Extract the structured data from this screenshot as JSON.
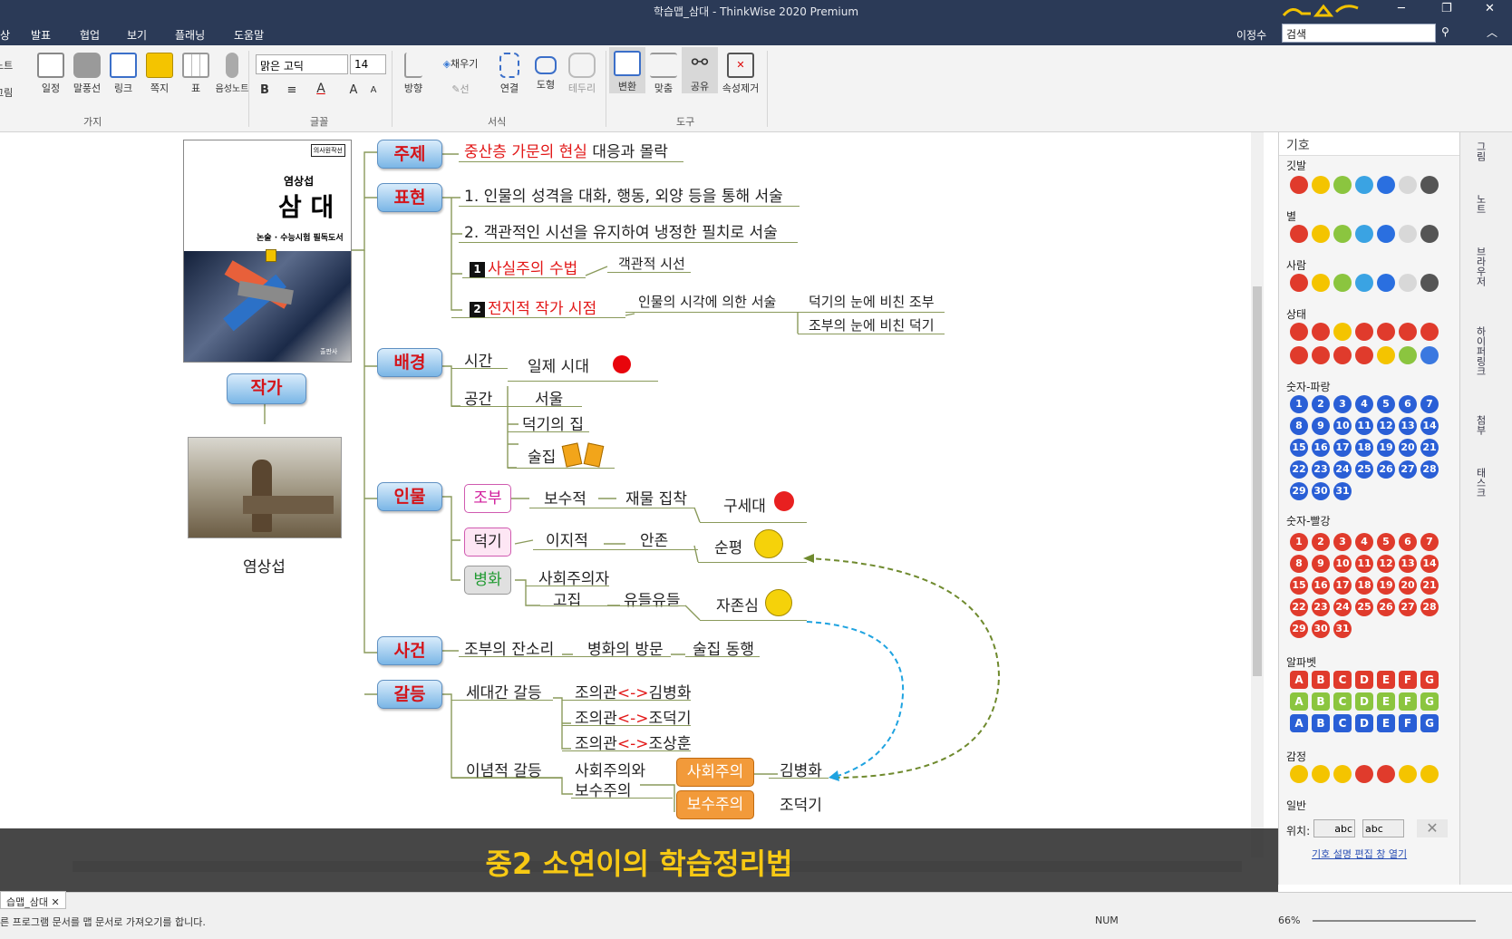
{
  "window": {
    "title": "학습맵_삼대 - ThinkWise 2020 Premium",
    "user": "이정수",
    "search_placeholder": "검색"
  },
  "menu": [
    "발표",
    "협업",
    "보기",
    "플래닝",
    "도움말"
  ],
  "menu_left_partial": "상",
  "ribbon": {
    "left_partial": [
      "노트",
      "그림"
    ],
    "branch": [
      "일정",
      "말풍선",
      "링크",
      "쪽지",
      "표",
      "음성노트"
    ],
    "branch_group": "가지",
    "font_name": "맑은 고딕",
    "font_size": "14",
    "font_group": "글꼴",
    "style": [
      "방향",
      "채우기",
      "선",
      "연결",
      "도형",
      "테두리"
    ],
    "style_group": "서식",
    "tools": [
      "변환",
      "맞춤",
      "공유",
      "속성제거"
    ],
    "tools_group": "도구"
  },
  "map": {
    "book": {
      "series": "의사원작선",
      "author": "염상섭",
      "title": "삼 대",
      "subtitle": "논술 · 수능시험 필독도서",
      "publisher": "출판사"
    },
    "author_label": "작가",
    "author_name": "염상섭",
    "topics": [
      "주제",
      "표현",
      "배경",
      "인물",
      "사건",
      "갈등"
    ],
    "theme": {
      "red": "중산층 가문의 현실",
      "black": "대응과 몰락"
    },
    "expr": {
      "e1": "1. 인물의 성격을 대화, 행동, 외양 등을 통해 서술",
      "e2": "2. 객관적인 시선을 유지하여 냉정한 필치로 서술",
      "n1": "1",
      "t1": "사실주의 수법",
      "t1c": "객관적 시선",
      "n2": "2",
      "t2": "전지적 작가 시점",
      "t2c": "인물의 시각에 의한 서술",
      "t2d1": "덕기의 눈에 비친 조부",
      "t2d2": "조부의 눈에 비친 덕기"
    },
    "setting": {
      "time": "시간",
      "time_v": "일제 시대",
      "space": "공간",
      "s1": "서울",
      "s2": "덕기의 집",
      "s3": "술집"
    },
    "chars": {
      "c1": "조부",
      "c1a": "보수적",
      "c1b": "재물 집착",
      "c1c": "구세대",
      "c2": "덕기",
      "c2a": "이지적",
      "c2b": "안존",
      "c2c": "순평",
      "c3": "병화",
      "c3a": "사회주의자",
      "c3b": "고집",
      "c3c": "유들유들",
      "c3d": "자존심"
    },
    "events": {
      "e1": "조부의 잔소리",
      "e2": "병화의 방문",
      "e3": "술집 동행"
    },
    "conflict": {
      "g1": "세대간 갈등",
      "g1a": "조의관",
      "g1b": "조의관",
      "g1c": "조의관",
      "arrow": "<->",
      "g1a2": "김병화",
      "g1b2": "조덕기",
      "g1c2": "조상훈",
      "g2": "이념적 갈등",
      "g2a": "사회주의와",
      "g2b": "보수주의",
      "g2c": "사회주의",
      "g2d": "김병화",
      "g2e": "보수주의",
      "g2f": "조덕기"
    }
  },
  "symbols": {
    "title": "기호",
    "sections": [
      "깃발",
      "별",
      "사람",
      "상태",
      "숫자-파랑",
      "숫자-빨강",
      "알파벳",
      "감정",
      "일반"
    ],
    "letters": [
      "A",
      "B",
      "C",
      "D",
      "E",
      "F",
      "G"
    ],
    "position_label": "위치:",
    "pos1": "abc",
    "pos2": "abc",
    "link": "기호 설명 편집 창 열기"
  },
  "vtabs": [
    "그림",
    "노트",
    "브라우저",
    "하이퍼링크",
    "첨부",
    "태스크"
  ],
  "banner": "중2 소연이의 학습정리법",
  "status": {
    "doc_tab": "습맵_삼대",
    "message": "른 프로그램 문서를 맵 문서로 가져오기를 합니다.",
    "num": "NUM",
    "zoom": "66%"
  },
  "colors": {
    "topic_red": "#d4141a",
    "accent": "#f7c914",
    "titlebar": "#2b3a57"
  }
}
